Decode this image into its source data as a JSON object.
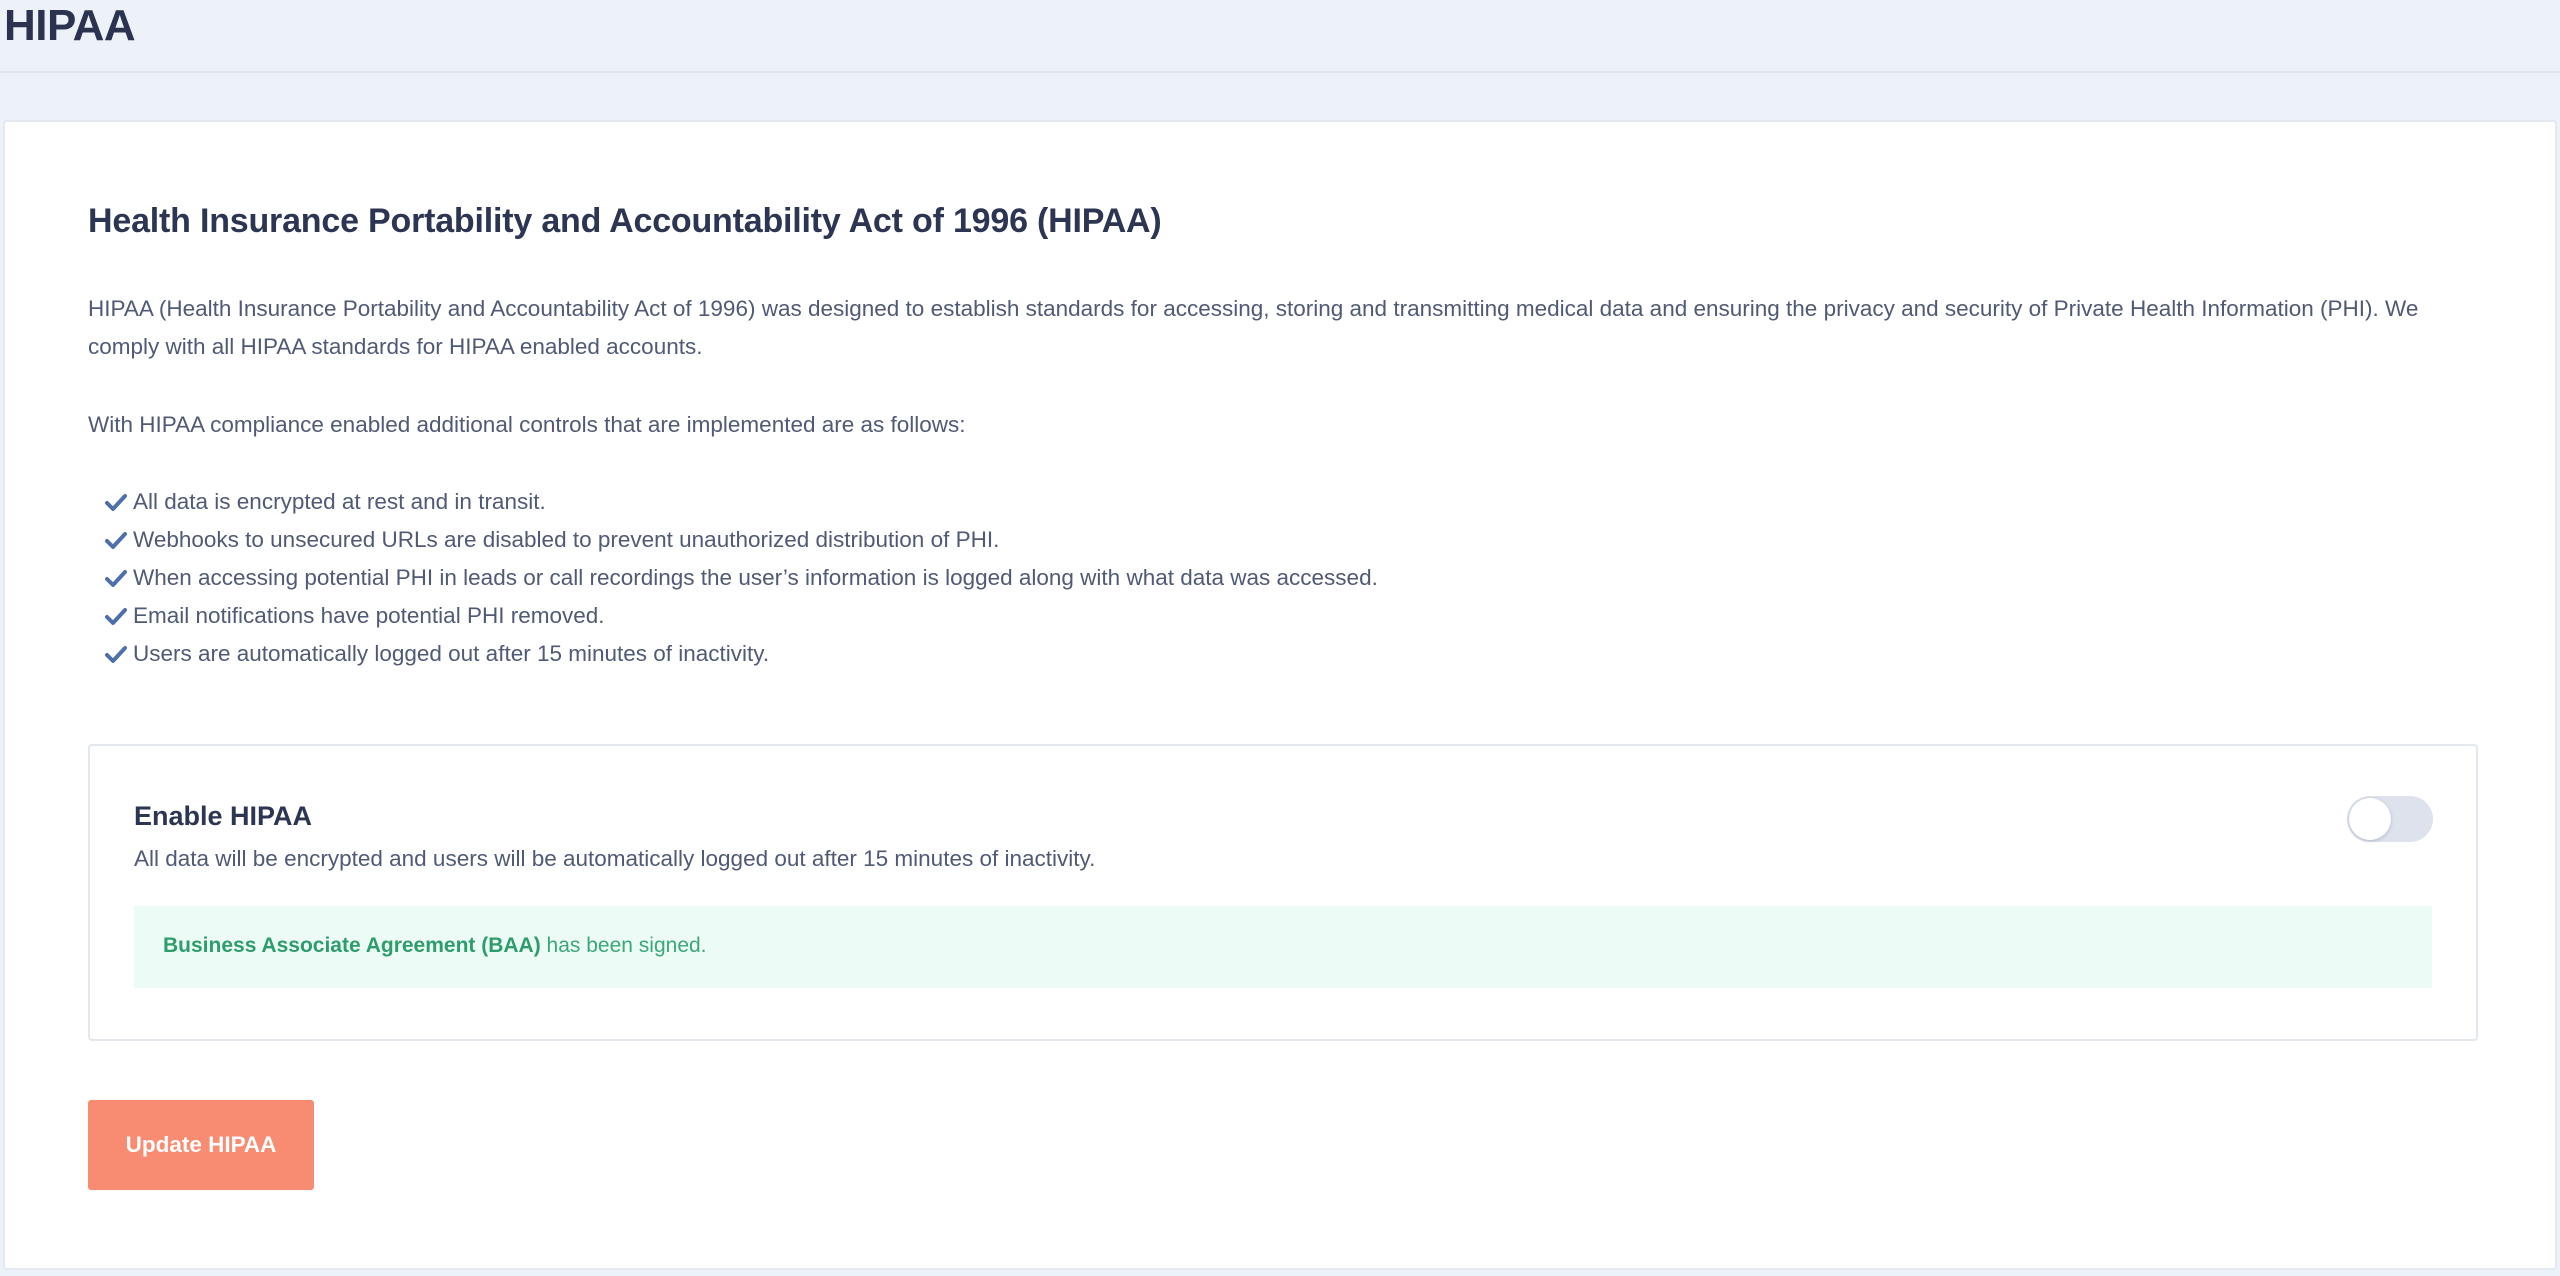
{
  "page": {
    "title": "HIPAA"
  },
  "section": {
    "heading": "Health Insurance Portability and Accountability Act of 1996 (HIPAA)",
    "intro": "HIPAA (Health Insurance Portability and Accountability Act of 1996) was designed to establish standards for accessing, storing and transmitting medical data and ensuring the privacy and security of Private Health Information (PHI). We comply with all HIPAA standards for HIPAA enabled accounts.",
    "controls_intro": "With HIPAA compliance enabled additional controls that are implemented are as follows:",
    "controls": [
      "All data is encrypted at rest and in transit.",
      "Webhooks to unsecured URLs are disabled to prevent unauthorized distribution of PHI.",
      "When accessing potential PHI in leads or call recordings the user’s information is logged along with what data was accessed.",
      "Email notifications have potential PHI removed.",
      "Users are automatically logged out after 15 minutes of inactivity."
    ],
    "check_icon": "check-icon",
    "check_color": "#4f6fab"
  },
  "enable": {
    "title": "Enable HIPAA",
    "description": "All data will be encrypted and users will be automatically logged out after 15 minutes of inactivity.",
    "toggle_on": false
  },
  "baa": {
    "strong": "Business Associate Agreement (BAA)",
    "text": " has been signed.",
    "color": "#3aa879"
  },
  "actions": {
    "update_label": "Update HIPAA",
    "update_color": "#f78c72"
  }
}
